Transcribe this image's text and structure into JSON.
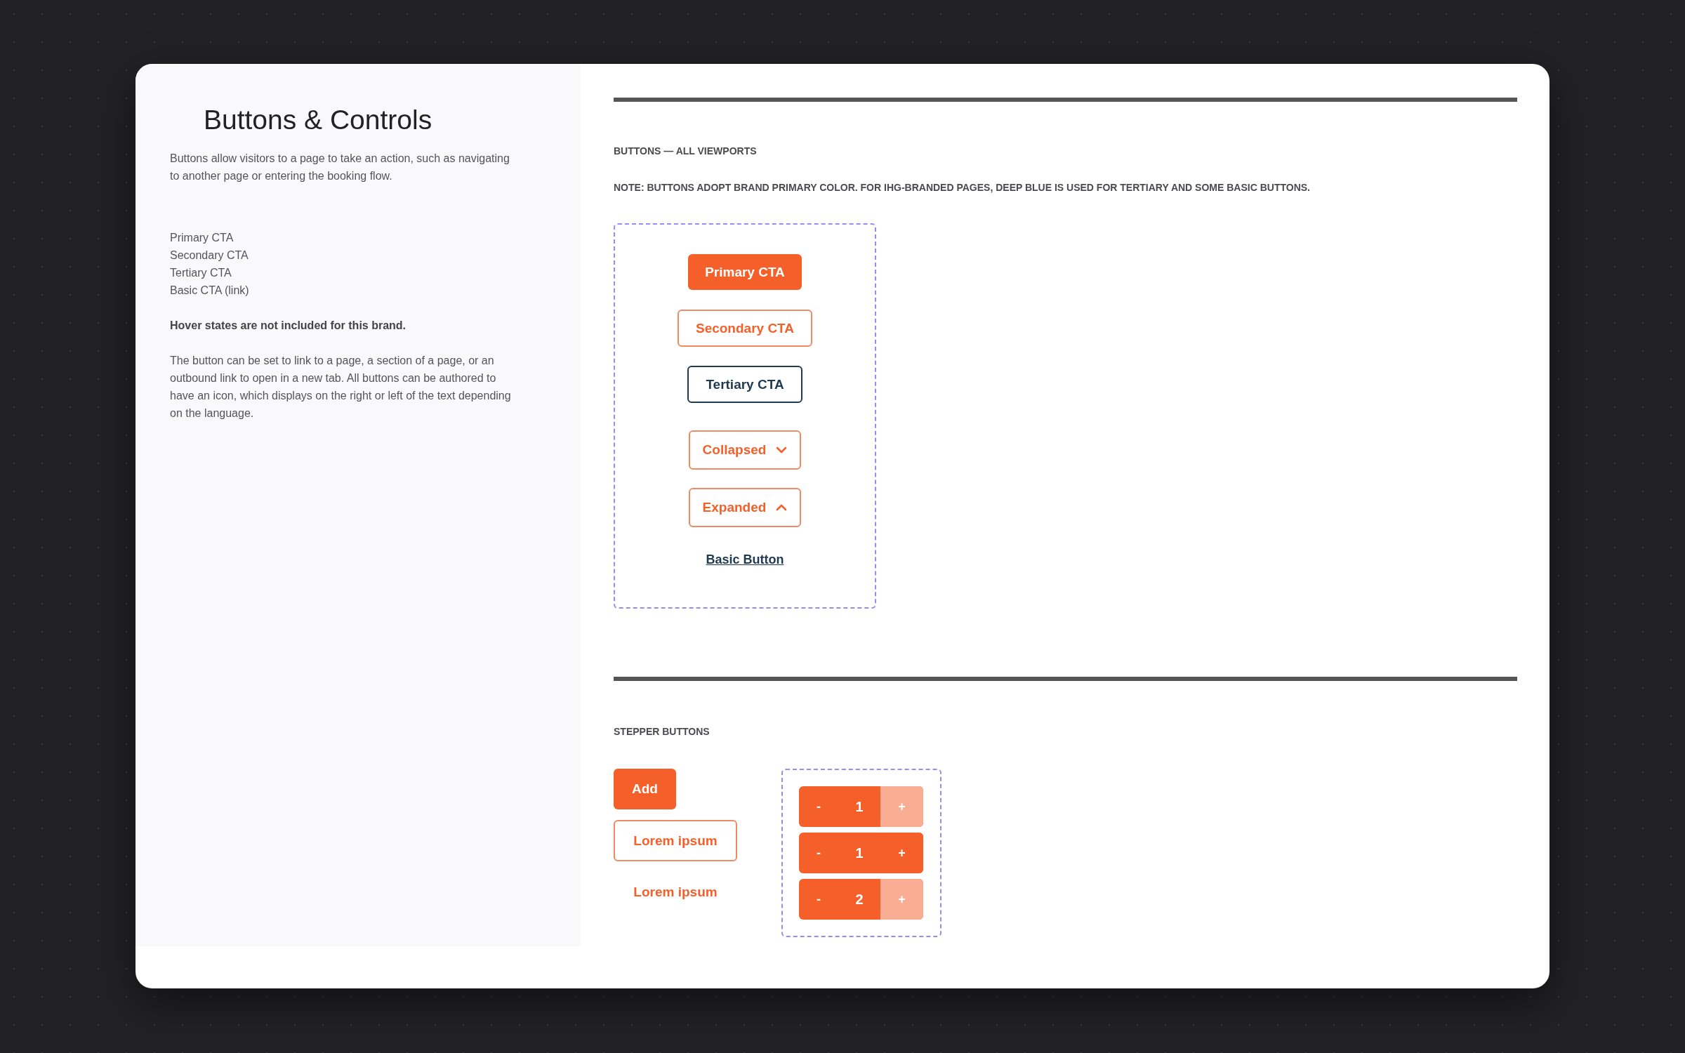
{
  "sidebar": {
    "title": "Buttons & Controls",
    "intro": "Buttons allow visitors to a page to take an action, such as navigating to another page or entering the booking flow.",
    "types": [
      "Primary CTA",
      "Secondary CTA",
      "Tertiary CTA",
      "Basic CTA (link)"
    ],
    "note": "Hover states are not included for this brand.",
    "details": "The button can be set to link to a page, a section of a page, or an outbound link to open in a new tab. All buttons can be authored to have an icon, which displays on the right or left of the text depending on the language."
  },
  "buttons_section": {
    "title": "BUTTONS — ALL VIEWPORTS",
    "note": "NOTE: BUTTONS ADOPT BRAND PRIMARY COLOR. FOR IHG-BRANDED PAGES, DEEP BLUE IS USED FOR TERTIARY AND SOME BASIC BUTTONS.",
    "buttons": [
      {
        "kind": "primary",
        "label": "Primary CTA"
      },
      {
        "kind": "secondary",
        "label": "Secondary CTA"
      },
      {
        "kind": "tertiary",
        "label": "Tertiary CTA"
      },
      {
        "kind": "dropdown",
        "label": "Collapsed",
        "expanded": false
      },
      {
        "kind": "dropdown",
        "label": "Expanded",
        "expanded": true
      },
      {
        "kind": "link",
        "label": "Basic Button"
      }
    ]
  },
  "stepper_section": {
    "title": "STEPPER BUTTONS",
    "buttons": [
      {
        "kind": "filled",
        "label": "Add"
      },
      {
        "kind": "outline",
        "label": "Lorem ipsum"
      },
      {
        "kind": "text",
        "label": "Lorem ipsum"
      }
    ],
    "steppers": [
      {
        "decrement": "-",
        "value": "1",
        "increment": {
          "label": "+",
          "disabled": true
        }
      },
      {
        "decrement": "-",
        "value": "1",
        "increment": {
          "label": "+",
          "disabled": false
        }
      },
      {
        "decrement": "-",
        "value": "2",
        "increment": {
          "label": "+",
          "disabled": true
        }
      }
    ]
  }
}
